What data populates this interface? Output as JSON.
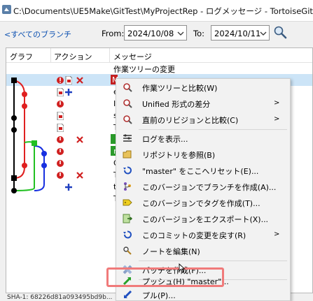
{
  "window": {
    "title": "C:\\Documents\\UE5Make\\GitTest\\MyProjectRep - ログメッセージ - TortoiseGit"
  },
  "filter": {
    "branches_link": "<すべてのブランチ",
    "from_label": "From:",
    "from_date": "2024/10/08",
    "to_label": "To:",
    "to_date": "2024/10/11"
  },
  "columns": {
    "graph": "グラフ",
    "actions": "アクション",
    "message": "メッセージ"
  },
  "rows": [
    {
      "message": "作業ツリーの変更"
    },
    {
      "message": "M"
    },
    {
      "message": "e"
    },
    {
      "message": "I"
    },
    {
      "message": "s"
    },
    {
      "message": "T"
    },
    {
      "message": ""
    },
    {
      "message": "n"
    },
    {
      "message": "G"
    },
    {
      "message": "T"
    },
    {
      "message": "t"
    },
    {
      "message": "T"
    }
  ],
  "context_menu": {
    "items": [
      {
        "label": "作業ツリーと比較(W)",
        "icon": "magnifier-icon",
        "submenu": false
      },
      {
        "label": "Unified 形式の差分",
        "icon": "magnifier-icon",
        "submenu": true
      },
      {
        "label": "直前のリビジョンと比較(C)",
        "icon": "magnifier-icon",
        "submenu": true
      },
      {
        "label": "ログを表示...",
        "icon": "log-icon",
        "submenu": false
      },
      {
        "label": "リポジトリを参照(B)",
        "icon": "folder-icon",
        "submenu": false
      },
      {
        "label": "\"master\" をここへリセット(E)...",
        "icon": "reset-icon",
        "submenu": false
      },
      {
        "label": "このバージョンでブランチを作成(A)...",
        "icon": "branch-icon",
        "submenu": false
      },
      {
        "label": "このバージョンでタグを作成(T)...",
        "icon": "tag-icon",
        "submenu": false
      },
      {
        "label": "このバージョンをエクスポート(X)...",
        "icon": "export-icon",
        "submenu": false
      },
      {
        "label": "このコミットの変更を戻す(R)",
        "icon": "revert-icon",
        "submenu": true
      },
      {
        "label": "ノートを編集(N)",
        "icon": "note-icon",
        "submenu": false
      },
      {
        "label": "パッチを作成(F)...",
        "icon": "patch-icon",
        "submenu": false
      },
      {
        "label": "プッシュ(H) \"master\"...",
        "icon": "push-icon",
        "submenu": false
      },
      {
        "label": "プル(P)...",
        "icon": "pull-icon",
        "submenu": false
      }
    ]
  },
  "status": {
    "sha": "SHA-1: 68226d81a093495bd9b..."
  },
  "colors": {
    "graph_red": "#e02020",
    "graph_green": "#22c022",
    "graph_blue": "#1830e0",
    "highlight": "#f07a7a",
    "selection": "#cce4f7"
  }
}
